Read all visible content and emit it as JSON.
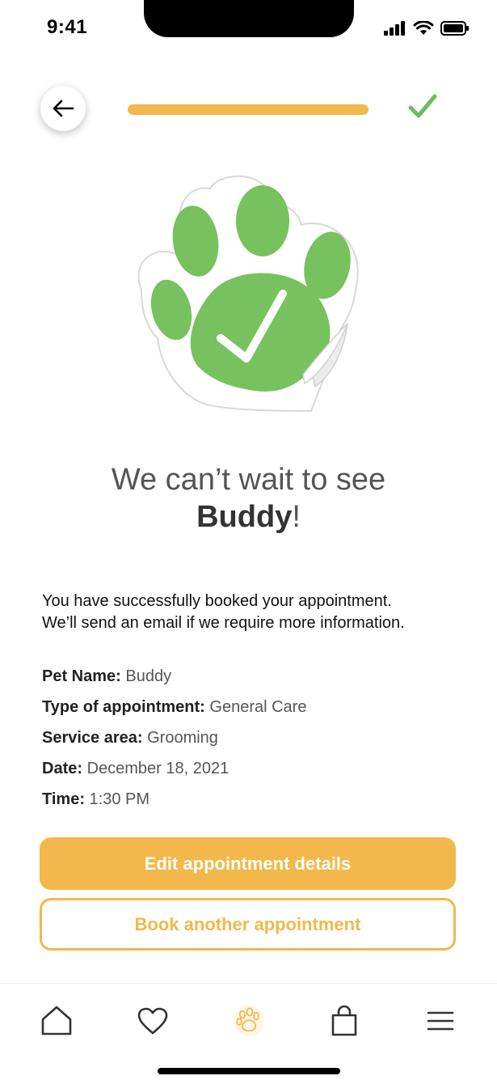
{
  "status_bar": {
    "time": "9:41"
  },
  "header": {
    "progress": 1.0
  },
  "hero": {
    "icon": "paw-check-sticker"
  },
  "headline": {
    "line1": "We can’t wait to see",
    "pet_name": "Buddy",
    "punct": "!"
  },
  "message": {
    "line1": "You have successfully booked your appointment.",
    "line2": "We’ll send an email if we require more information."
  },
  "details": [
    {
      "label": "Pet Name:",
      "value": "Buddy"
    },
    {
      "label": "Type of appointment:",
      "value": "General Care"
    },
    {
      "label": "Service area:",
      "value": "Grooming"
    },
    {
      "label": "Date:",
      "value": "December 18, 2021"
    },
    {
      "label": "Time:",
      "value": "1:30 PM"
    }
  ],
  "buttons": {
    "edit": "Edit appointment details",
    "book_another": "Book another appointment"
  },
  "tabs": [
    "home-icon",
    "heart-icon",
    "paw-icon",
    "bag-icon",
    "menu-icon"
  ],
  "colors": {
    "accent": "#F2B84B",
    "success": "#6BBE5A",
    "paw_green": "#77C25E"
  }
}
